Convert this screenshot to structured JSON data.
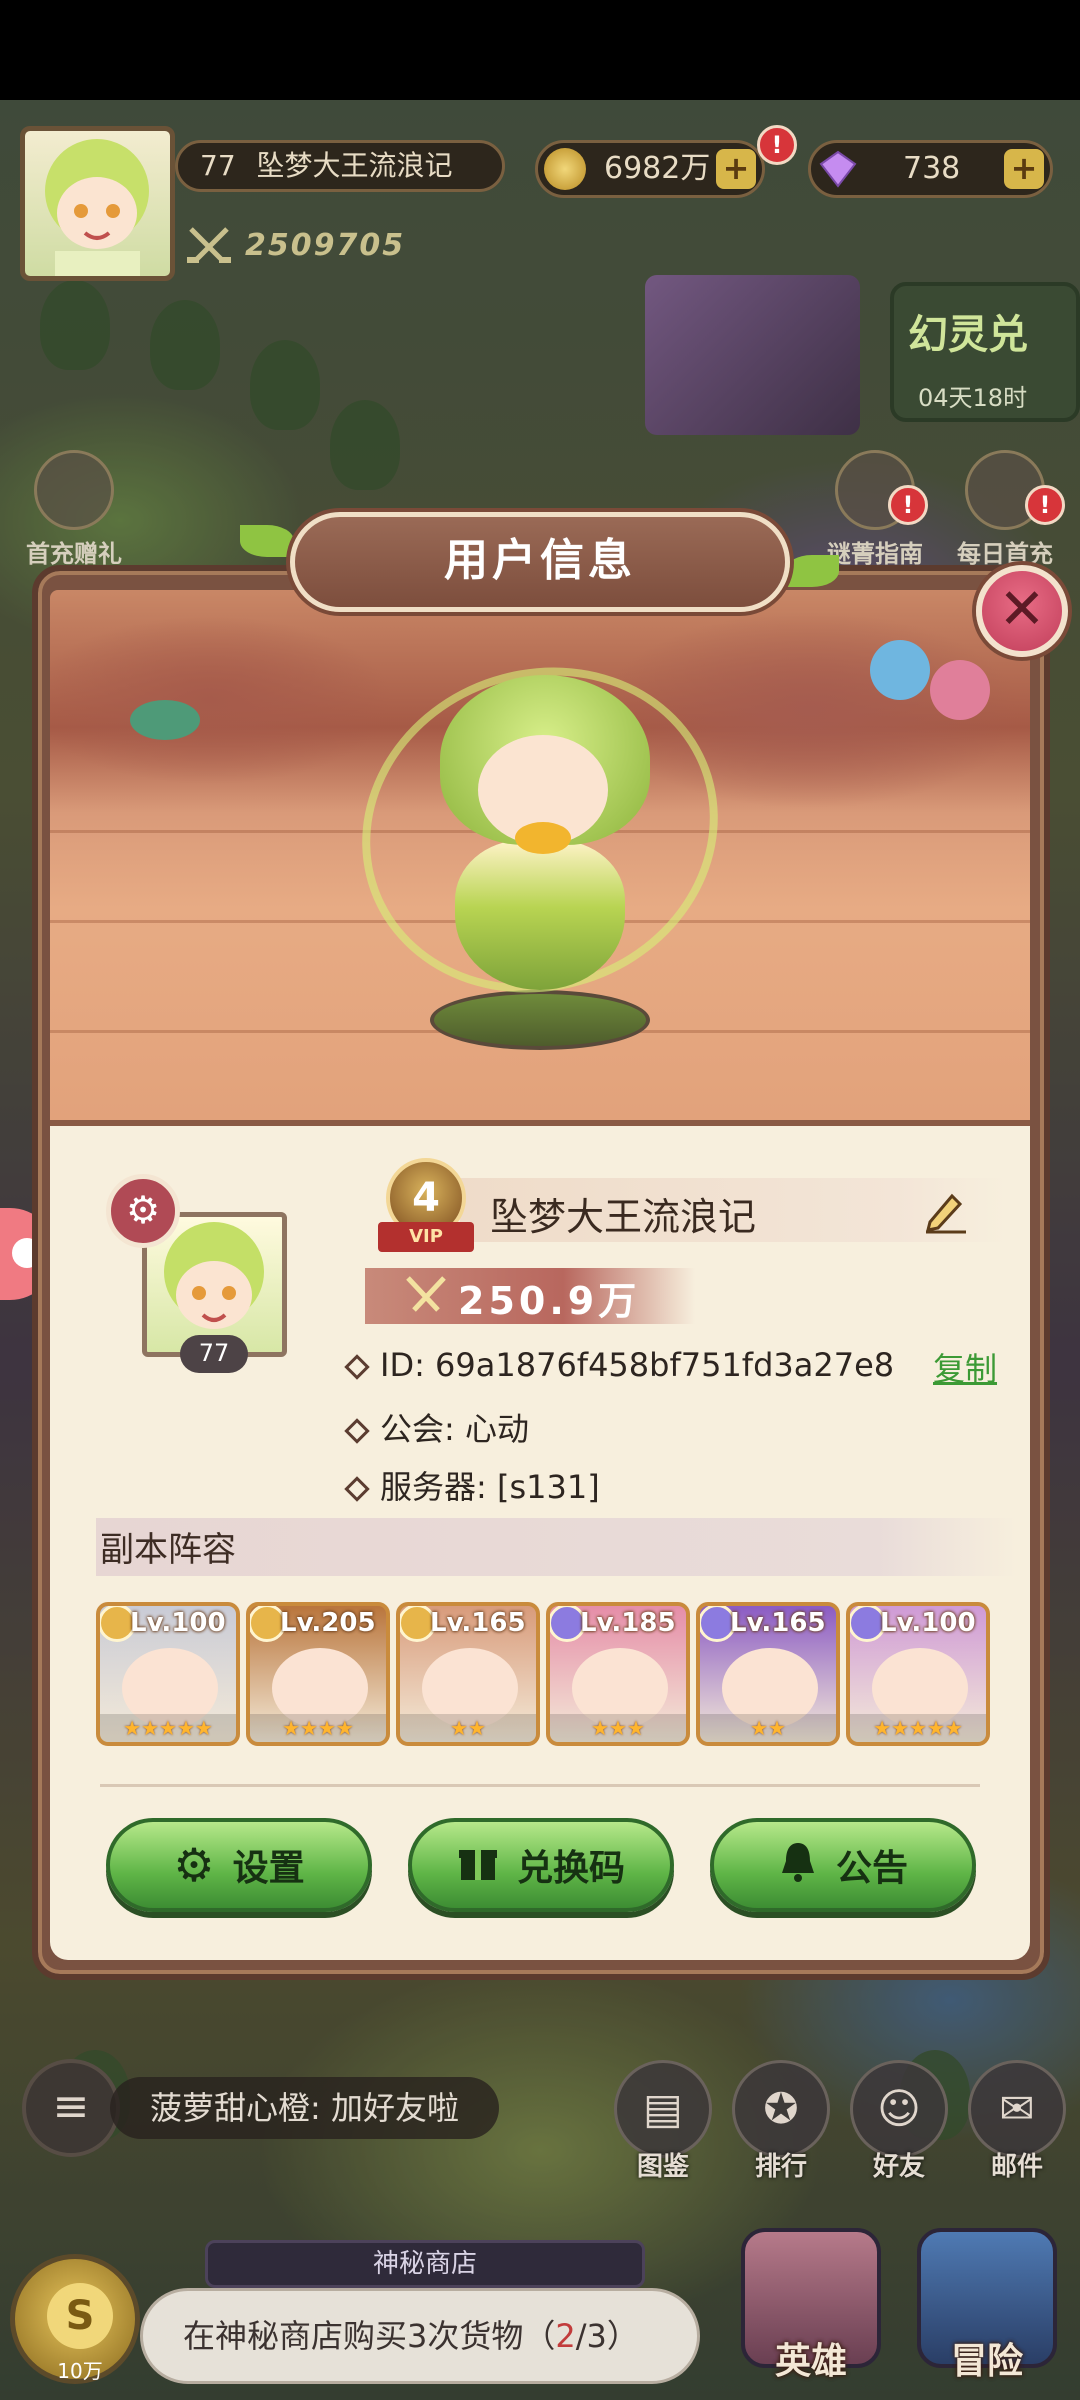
{
  "hud": {
    "player_level": "77",
    "player_name": "坠梦大王流浪记",
    "power": "2509705",
    "gold": "6982万",
    "gems": "738",
    "gold_alert": "!",
    "event_title": "幻灵兑",
    "event_timer": "04天18时",
    "first_recharge": "首充赠礼",
    "guide": "谜菁指南",
    "daily": "每日首充",
    "alert": "!"
  },
  "dialog": {
    "title": "用户信息",
    "close_icon": "close-icon",
    "vip_level": "4",
    "vip_label": "VIP",
    "name": "坠梦大王流浪记",
    "avatar_level": "77",
    "power": "250.9万",
    "id_label": "ID: 69a1876f458bf751fd3a27e8",
    "copy_label": "复制",
    "guild_label": "公会: 心动",
    "server_label": "服务器: [s131]",
    "lineup_title": "副本阵容",
    "heroes": [
      {
        "level": "Lv.100",
        "stars": "★★★★★",
        "badge_color": "#e7b54a",
        "bg": "#c9cbd6"
      },
      {
        "level": "Lv.205",
        "stars": "★★★★",
        "badge_color": "#e7b54a",
        "bg": "#b9753c"
      },
      {
        "level": "Lv.165",
        "stars": "★★",
        "badge_color": "#e7b54a",
        "bg": "#d89b7b"
      },
      {
        "level": "Lv.185",
        "stars": "★★★",
        "badge_color": "#8c7be0",
        "bg": "#e58da8"
      },
      {
        "level": "Lv.165",
        "stars": "★★",
        "badge_color": "#8c7be0",
        "bg": "#8b5bc4"
      },
      {
        "level": "Lv.100",
        "stars": "★★★★★",
        "badge_color": "#8c7be0",
        "bg": "#cf9ad6"
      }
    ],
    "buttons": {
      "settings": "设置",
      "redeem": "兑换码",
      "notice": "公告"
    }
  },
  "bottom": {
    "chat_text": "菠萝甜心橙: 加好友啦",
    "dock": [
      "图鉴",
      "排行",
      "好友",
      "邮件"
    ],
    "quest_head": "神秘商店",
    "quest_text_before": "在神秘商店购买3次货物（",
    "quest_progress": "2",
    "quest_text_after": "/3）",
    "coin_amount": "10万",
    "hero_btn": "英雄",
    "adventure_btn": "冒险"
  },
  "colors": {
    "panel_bg": "#f7efdd",
    "frame": "#7a5241",
    "button_green": "#5fb547",
    "close_pink": "#c13e5a",
    "copy_green": "#3c9a35"
  }
}
